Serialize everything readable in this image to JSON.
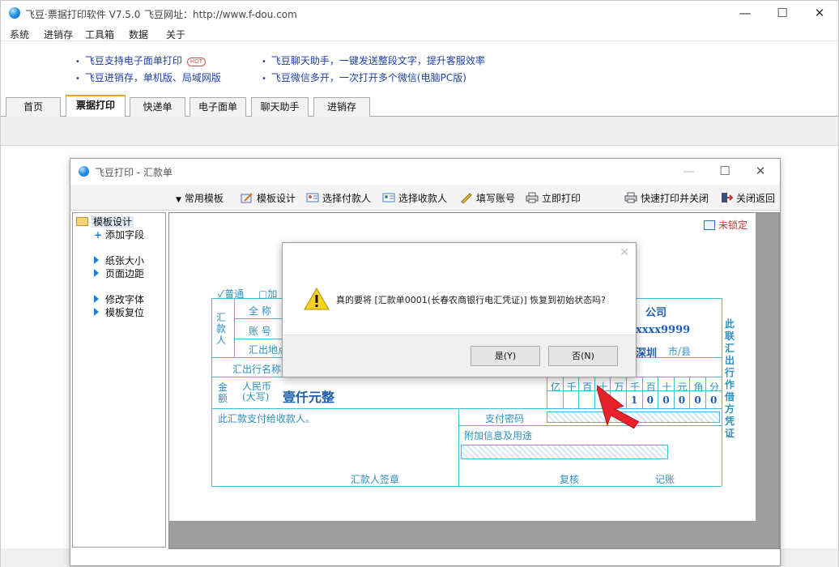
{
  "app": {
    "title": "飞豆·票据打印软件 V7.5.0",
    "site": "飞豆网址：http://www.f-dou.com",
    "controls": {
      "minimize": "—",
      "maximize": "☐",
      "close": "✕"
    }
  },
  "menu": [
    "系统",
    "进销存",
    "工具箱",
    "数据",
    "关于"
  ],
  "ads": {
    "left": [
      "飞豆支持电子面单打印",
      "飞豆进销存，单机版、局域网版"
    ],
    "right": [
      "飞豆聊天助手，一键发送整段文字，提升客服效率",
      "飞豆微信多开，一次打开多个微信(电脑PC版)"
    ],
    "hot_badge": "HOT"
  },
  "tabs": [
    "首页",
    "票据打印",
    "快递单",
    "电子面单",
    "聊天助手",
    "进销存"
  ],
  "active_tab": "票据打印",
  "inner": {
    "title": "飞豆打印 - 汇款单",
    "toolbar": {
      "template_dropdown": "常用模板",
      "design": "模板设计",
      "payer": "选择付款人",
      "payee": "选择收款人",
      "account": "填写账号",
      "print": "立即打印",
      "quick_print": "快速打印并关闭",
      "close_return": "关闭返回"
    },
    "tree": {
      "root": "模板设计",
      "items": [
        "添加字段",
        "纸张大小",
        "页面边距",
        "修改字体",
        "模板复位"
      ]
    },
    "lock_status": "未锁定",
    "form": {
      "mode_normal": "普通",
      "mode_urgent": "加",
      "remitter_side": "汇款人",
      "full_name_label": "全 称",
      "account_label": "账 号",
      "from_place_label": "汇出地点",
      "from_bank_label": "汇出行名称",
      "payee_name_tail": "公司",
      "payee_account_tail": "xxxx9999",
      "payee_city": "深圳",
      "city_unit": "市/县",
      "amount_label": "金额",
      "rmb_label": "人民币\n(大写)",
      "amount_words": "壹仟元整",
      "digit_headers": [
        "亿",
        "千",
        "百",
        "十",
        "万",
        "千",
        "百",
        "十",
        "元",
        "角",
        "分"
      ],
      "digits": [
        "",
        "",
        "",
        "",
        "",
        "1",
        "0",
        "0",
        "0",
        "0",
        "0"
      ],
      "pay_note": "此汇款支付给收款人。",
      "pay_password_label": "支付密码",
      "extra_info_label": "附加信息及用途",
      "remitter_sign": "汇款人签章",
      "review": "复核",
      "bookkeeping": "记账",
      "side_text": "此联汇出行作借方凭证"
    }
  },
  "dialog": {
    "message": "真的要将 [汇款单0001(长春农商银行电汇凭证)] 恢复到初始状态吗?",
    "yes": "是(Y)",
    "no": "否(N)",
    "close": "✕"
  },
  "colors": {
    "link_blue": "#1f3fa8",
    "form_cyan": "#47b8d8",
    "form_text": "#2e8fbf",
    "warn_red": "#d23030",
    "tab_accent": "#f0a020"
  }
}
